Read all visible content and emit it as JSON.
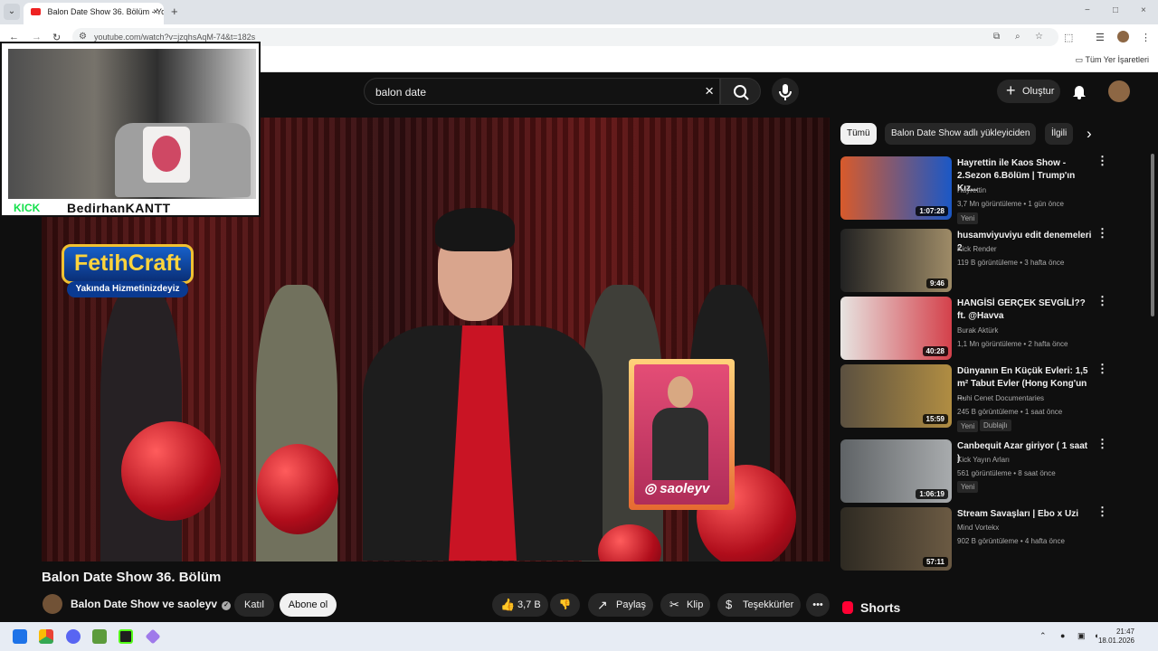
{
  "browser": {
    "tab_title": "Balon Date Show 36. Bölüm - Yo",
    "url": "youtube.com/watch?v=jzqhsAqM-74&t=182s",
    "bookmarks_label": "Tüm Yer İşaretleri"
  },
  "youtube": {
    "search_value": "balon date",
    "create_label": "Oluştur",
    "video_title": "Balon Date Show 36. Bölüm",
    "channel_name": "Balon Date Show ve saoleyv",
    "join_label": "Katıl",
    "subscribe_label": "Abone ol",
    "like_count": "3,7 B",
    "share_label": "Paylaş",
    "clip_label": "Klip",
    "thanks_label": "Teşekkürler"
  },
  "overlay": {
    "kick_label": "KICK",
    "streamer_name": "BedirhanKANTT",
    "fetih_title": "FetihCraft",
    "fetih_subtitle": "Yakında Hizmetinizdeyiz",
    "instagram_handle": "saoleyv"
  },
  "chips": [
    "Tümü",
    "Balon Date Show adlı yükleyiciden",
    "İlgili"
  ],
  "recommendations": [
    {
      "title": "Hayrettin ile Kaos Show - 2.Sezon 6.Bölüm | Trump'ın Kız...",
      "channel": "Hayrettin",
      "views": "3,7 Mn görüntüleme",
      "age": "1 gün önce",
      "duration": "1:07:28",
      "badge": "Yeni",
      "thumb_color": "#d85a2b"
    },
    {
      "title": "husamviyuviyu edit denemeleri 2",
      "channel": "Kick Render",
      "views": "119 B görüntüleme",
      "age": "3 hafta önce",
      "duration": "9:46",
      "badge": "",
      "thumb_color": "#9e8b67"
    },
    {
      "title": "HANGİSİ GERÇEK SEVGİLİ?? ft. @Havva",
      "channel": "Burak Aktürk",
      "views": "1,1 Mn görüntüleme",
      "age": "2 hafta önce",
      "duration": "40:28",
      "badge": "",
      "thumb_color": "#d4414b"
    },
    {
      "title": "Dünyanın En Küçük Evleri: 1,5 m² Tabut Evler (Hong Kong'un ...",
      "channel": "Ruhi Cenet Documentaries",
      "views": "245 B görüntüleme",
      "age": "1 saat önce",
      "duration": "15:59",
      "badge": "Yeni",
      "badge2": "Dublajlı",
      "thumb_color": "#7a6e45"
    },
    {
      "title": "Canbequit  Azar giriyor ( 1 saat )",
      "channel": "Kick Yayın Arları",
      "views": "561 görüntüleme",
      "age": "8 saat önce",
      "duration": "1:06:19",
      "badge": "Yeni",
      "thumb_color": "#8c8f92"
    },
    {
      "title": "Stream Savaşları | Ebo x Uzi",
      "channel": "Mind Vortekx",
      "views": "902 B görüntüleme",
      "age": "4 hafta önce",
      "duration": "57:11",
      "badge": "",
      "thumb_color": "#3d3328"
    }
  ],
  "sections": {
    "shorts": "Shorts"
  },
  "taskbar": {
    "time": "21:47",
    "date": "18.01.2026"
  }
}
